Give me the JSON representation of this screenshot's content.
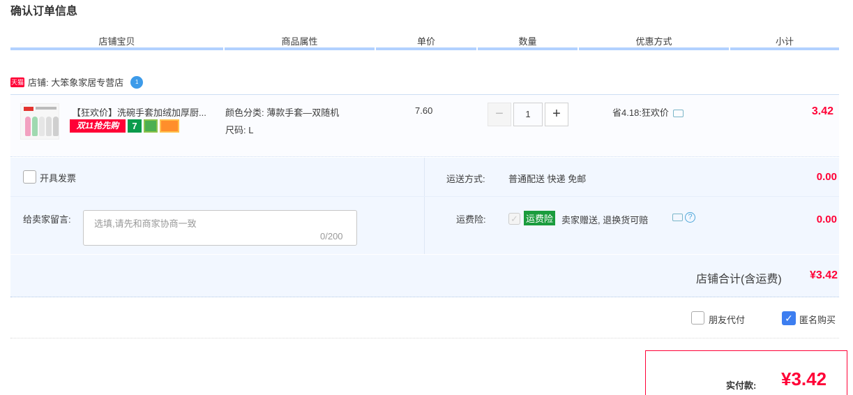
{
  "page_title": "确认订单信息",
  "columns": [
    "店铺宝贝",
    "商品属性",
    "单价",
    "数量",
    "优惠方式",
    "小计"
  ],
  "shop": {
    "tag": "天猫",
    "label": "店铺: 大笨象家居专营店"
  },
  "item": {
    "title": "【狂欢价】洗碗手套加绒加厚厨...",
    "badge_double11": "双11抢先购",
    "badge_seven": "7",
    "attr_color": "颜色分类: 薄款手套—双随机",
    "attr_size": "尺码: L",
    "price": "7.60",
    "quantity": "1",
    "minus": "−",
    "plus": "+",
    "discount": "省4.18:狂欢价",
    "subtotal": "3.42"
  },
  "options": {
    "invoice_label": "开具发票",
    "shipping_label": "运送方式:",
    "shipping_value": "普通配送 快递 免邮",
    "shipping_fee": "0.00",
    "memo_label": "给卖家留言:",
    "memo_placeholder": "选填,请先和商家协商一致",
    "memo_count": "0/200",
    "insurance_label": "运费险:",
    "insurance_tag": "运费险",
    "insurance_text": "卖家赠送, 退换货可赔",
    "insurance_fee": "0.00"
  },
  "shop_total": {
    "label": "店铺合计(含运费)",
    "value": "¥3.42"
  },
  "checkboxes": {
    "friend_pay": "朋友代付",
    "anonymous": "匿名购买"
  },
  "payment": {
    "label": "实付款:",
    "value": "¥3.42"
  },
  "colors": {
    "accent": "#ff0036",
    "header_bar": "#b2d1ff",
    "panel": "#f2f7ff"
  }
}
